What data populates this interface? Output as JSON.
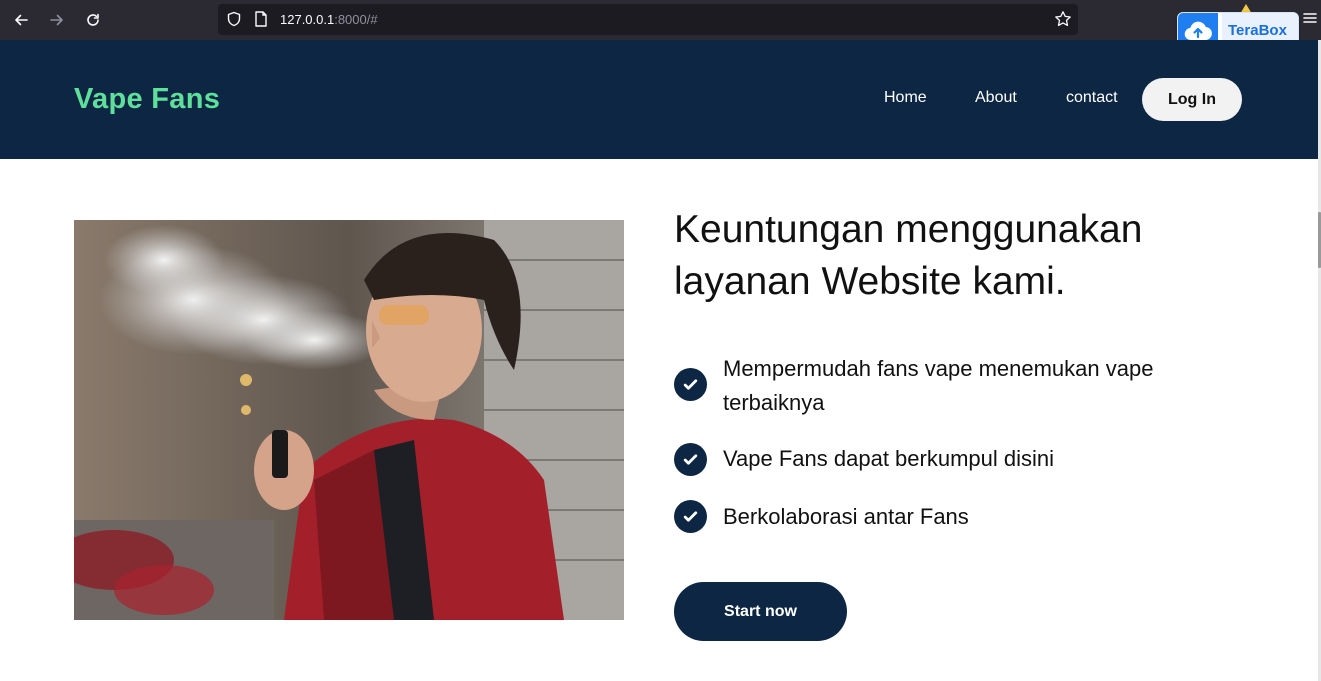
{
  "browser": {
    "url_host": "127.0.0.1",
    "url_rest": ":8000/#",
    "extension_label": "TeraBox"
  },
  "site": {
    "brand": "Vape Fans",
    "nav": [
      "Home",
      "About",
      "contact"
    ],
    "login_label": "Log In"
  },
  "content": {
    "headline": "Keuntungan menggunakan layanan Website kami.",
    "benefits": [
      "Mempermudah fans vape menemukan vape terbaiknya",
      "Vape Fans dapat berkumpul disini",
      "Berkolaborasi antar Fans"
    ],
    "cta_label": "Start now"
  },
  "colors": {
    "header_bg": "#0c2643",
    "brand_green": "#5ee09b",
    "accent_dark": "#0c2643"
  }
}
